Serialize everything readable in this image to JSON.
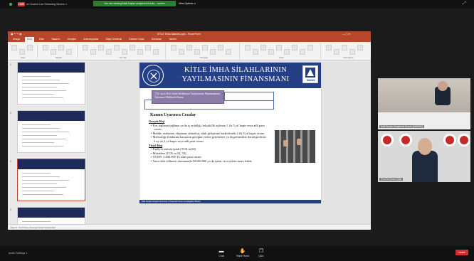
{
  "topbar": {
    "live_label": "LIVE",
    "stream_text": "on Custom Live Streaming Service ∨",
    "share_banner": "You are viewing Mali Suçları Araştırma Kurulu... screen",
    "view_options": "View Options ∨",
    "expand_icon": "expand-icon"
  },
  "ppt": {
    "title": "KİTLE İmha Silahları.pptx - PowerPoint",
    "tabs": [
      "Dosya",
      "Giriş",
      "Ekle",
      "Tasarım",
      "Geçişler",
      "Animasyonlar",
      "Slayt Gösterisi",
      "Gözden Geçir",
      "Görünüm",
      "Yardım"
    ],
    "active_tab": "Giriş",
    "ribbon_groups": [
      "Pano",
      "Slaytlar",
      "Yazı Tipi",
      "Paragraf",
      "Çizim",
      "Düzenleme"
    ]
  },
  "thumbnails": {
    "numbers": [
      "1",
      "2",
      "3",
      "4"
    ]
  },
  "slide": {
    "title_line1": "KİTLE İMHA SİLAHLARININ",
    "title_line2": "YAYILMASININ FİNANSMANI",
    "logo_text": "MASAK",
    "callout": "7262 sayılı Kitle İmha Silahlarının Yayılmasının Finansmanının Önlenmesi Hakkında Kanun",
    "heading": "Kanun Uyarınca Cezalar",
    "gercek_kisi": "Gerçek Kişi",
    "bullets_gercek": [
      "Fon toplama/sağlama ya da iş ortaklığı /teknik/ilk açılması 1 ila 5 yıl hapis veya adli para cezası",
      "Madde, malzeme, ekipman, teknoloji, silah geliştirme katkı/destek 2 ila 8 yıl hapis cezası",
      "Malvarlığı dondurma kararının gereğini yerine getirmeme ya da getirmekte ihmal gecikme 6 ay ila 2 yıl hapis veya adli para cezası"
    ],
    "tuzel_kisi": "Tüzel Kişi",
    "bullets_tuzel": [
      "Faaliyet izninin iptali (TCK m.60)",
      "Müsadere (TCK m.54, 55),",
      "10.000- 2.000.000 TL idari para cezası",
      "Yarar elde edilmesi durumunda 50.000.000 ya da işlem veya eylem tutarı kadar"
    ],
    "footer": "Mali Suçları Araştırma Kurulu | Financial Crime Investigation Board"
  },
  "notes_bar": "Slayt 3 / 24   Türkçe (Türkiye)   Notlar   Açıklamalar",
  "tiles": [
    {
      "label": "Mali Suçları Araştırma Kurulu (MASAK)"
    },
    {
      "label": "Prof.Dr.Ceren Çiftçi"
    }
  ],
  "bottombar": {
    "audio_settings": "Audio Settings ∨",
    "chat": "Chat",
    "raise_hand": "Raise Hand",
    "qa": "Q&A",
    "leave": "Leave"
  },
  "colors": {
    "ppt_accent": "#b7472a",
    "slide_navy": "#243f86",
    "callout_purple": "#8c7aa8",
    "live_red": "#d32f2f",
    "share_green": "#2e7d32"
  }
}
